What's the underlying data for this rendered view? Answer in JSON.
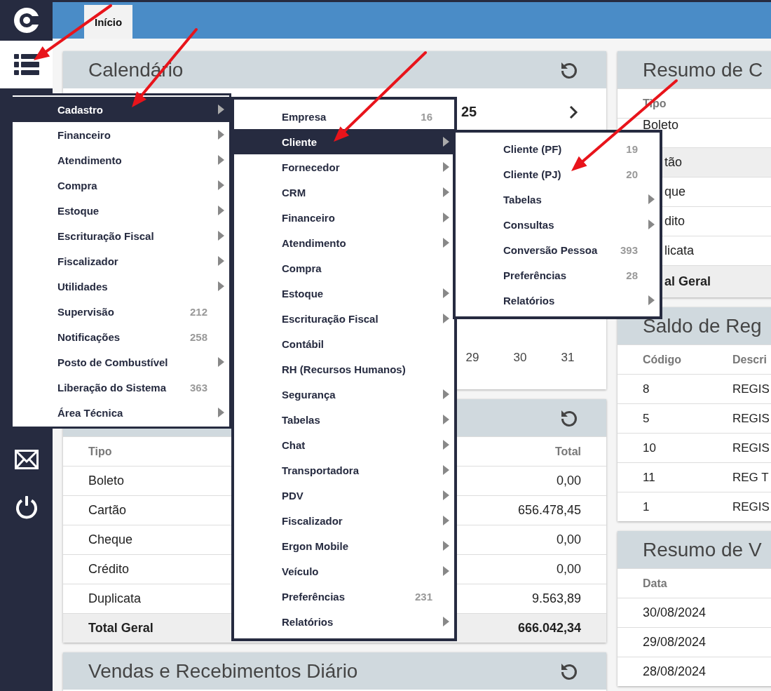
{
  "sidebar": {
    "items": [
      {
        "kind": "logo",
        "active": false
      },
      {
        "kind": "menu",
        "active": true
      },
      {
        "kind": "mail",
        "active": false
      },
      {
        "kind": "power",
        "active": false
      }
    ]
  },
  "tabs": [
    {
      "label": "Início",
      "selected": true
    }
  ],
  "calendar": {
    "title": "Calendário",
    "month_label": "25",
    "days": [
      "29",
      "30",
      "31"
    ]
  },
  "payments_panel": {
    "columns": [
      "Tipo",
      "Total"
    ],
    "rows": [
      {
        "cells": [
          "Boleto",
          "0,00"
        ],
        "total": false
      },
      {
        "cells": [
          "Cartão",
          "656.478,45"
        ],
        "total": false
      },
      {
        "cells": [
          "Cheque",
          "0,00"
        ],
        "total": false
      },
      {
        "cells": [
          "Crédito",
          "0,00"
        ],
        "total": false
      },
      {
        "cells": [
          "Duplicata",
          "9.563,89"
        ],
        "total": false
      },
      {
        "cells": [
          "Total Geral",
          "666.042,34"
        ],
        "total": true
      }
    ]
  },
  "daily_panel": {
    "title": "Vendas e Recebimentos Diário"
  },
  "summary_panel": {
    "title": "Resumo de C",
    "columns": [
      "Tipo"
    ],
    "rows": [
      {
        "cells": [
          "Boleto"
        ],
        "highlighted": false,
        "total": false
      },
      {
        "cells": [
          "tão"
        ],
        "highlighted": true,
        "total": false
      },
      {
        "cells": [
          "que"
        ],
        "highlighted": false,
        "total": false
      },
      {
        "cells": [
          "dito"
        ],
        "highlighted": false,
        "total": false
      },
      {
        "cells": [
          "licata"
        ],
        "highlighted": false,
        "total": false
      },
      {
        "cells": [
          "al Geral"
        ],
        "highlighted": false,
        "total": true
      }
    ]
  },
  "balance_panel": {
    "title": "Saldo de Reg",
    "columns": [
      "Código",
      "Descri"
    ],
    "rows": [
      {
        "cells": [
          "8",
          "REGIS"
        ]
      },
      {
        "cells": [
          "5",
          "REGIS"
        ]
      },
      {
        "cells": [
          "10",
          "REGIS"
        ]
      },
      {
        "cells": [
          "11",
          "REG T"
        ]
      },
      {
        "cells": [
          "1",
          "REGIS"
        ]
      }
    ]
  },
  "sales_panel": {
    "title": "Resumo de V",
    "columns": [
      "Data"
    ],
    "rows": [
      {
        "cells": [
          "30/08/2024"
        ]
      },
      {
        "cells": [
          "29/08/2024"
        ]
      },
      {
        "cells": [
          "28/08/2024"
        ]
      }
    ]
  },
  "menus": [
    {
      "items": [
        {
          "label": "Cadastro",
          "submenu": true,
          "selected": true
        },
        {
          "label": "Financeiro",
          "submenu": true,
          "selected": false
        },
        {
          "label": "Atendimento",
          "submenu": true,
          "selected": false
        },
        {
          "label": "Compra",
          "submenu": true,
          "selected": false
        },
        {
          "label": "Estoque",
          "submenu": true,
          "selected": false
        },
        {
          "label": "Escrituração Fiscal",
          "submenu": true,
          "selected": false
        },
        {
          "label": "Fiscalizador",
          "submenu": true,
          "selected": false
        },
        {
          "label": "Utilidades",
          "submenu": true,
          "selected": false
        },
        {
          "label": "Supervisão",
          "count": "212",
          "submenu": false,
          "selected": false
        },
        {
          "label": "Notificações",
          "count": "258",
          "submenu": false,
          "selected": false
        },
        {
          "label": "Posto de Combustível",
          "submenu": true,
          "selected": false
        },
        {
          "label": "Liberação do Sistema",
          "count": "363",
          "submenu": false,
          "selected": false
        },
        {
          "label": "Área Técnica",
          "submenu": true,
          "selected": false
        }
      ]
    },
    {
      "items": [
        {
          "label": "Empresa",
          "count": "16",
          "submenu": false,
          "selected": false
        },
        {
          "label": "Cliente",
          "submenu": true,
          "selected": true
        },
        {
          "label": "Fornecedor",
          "submenu": true,
          "selected": false
        },
        {
          "label": "CRM",
          "submenu": true,
          "selected": false
        },
        {
          "label": "Financeiro",
          "submenu": true,
          "selected": false
        },
        {
          "label": "Atendimento",
          "submenu": true,
          "selected": false
        },
        {
          "label": "Compra",
          "submenu": false,
          "selected": false
        },
        {
          "label": "Estoque",
          "submenu": true,
          "selected": false
        },
        {
          "label": "Escrituração Fiscal",
          "submenu": true,
          "selected": false
        },
        {
          "label": "Contábil",
          "submenu": false,
          "selected": false
        },
        {
          "label": "RH (Recursos Humanos)",
          "submenu": false,
          "selected": false
        },
        {
          "label": "Segurança",
          "submenu": true,
          "selected": false
        },
        {
          "label": "Tabelas",
          "submenu": true,
          "selected": false
        },
        {
          "label": "Chat",
          "submenu": true,
          "selected": false
        },
        {
          "label": "Transportadora",
          "submenu": true,
          "selected": false
        },
        {
          "label": "PDV",
          "submenu": true,
          "selected": false
        },
        {
          "label": "Fiscalizador",
          "submenu": true,
          "selected": false
        },
        {
          "label": "Ergon Mobile",
          "submenu": true,
          "selected": false
        },
        {
          "label": "Veículo",
          "submenu": true,
          "selected": false
        },
        {
          "label": "Preferências",
          "count": "231",
          "submenu": false,
          "selected": false
        },
        {
          "label": "Relatórios",
          "submenu": true,
          "selected": false
        }
      ]
    },
    {
      "items": [
        {
          "label": "Cliente (PF)",
          "count": "19",
          "submenu": false,
          "selected": false
        },
        {
          "label": "Cliente (PJ)",
          "count": "20",
          "submenu": false,
          "selected": false
        },
        {
          "label": "Tabelas",
          "submenu": true,
          "selected": false
        },
        {
          "label": "Consultas",
          "submenu": true,
          "selected": false
        },
        {
          "label": "Conversão Pessoa",
          "count": "393",
          "submenu": false,
          "selected": false
        },
        {
          "label": "Preferências",
          "count": "28",
          "submenu": false,
          "selected": false
        },
        {
          "label": "Relatórios",
          "submenu": true,
          "selected": false
        }
      ]
    }
  ]
}
